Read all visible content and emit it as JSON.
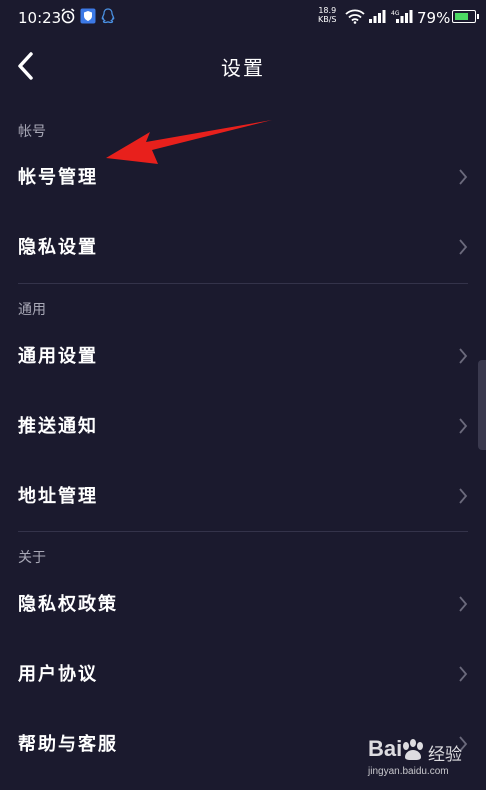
{
  "status_bar": {
    "time": "10:23",
    "net_speed_value": "18.9",
    "net_speed_unit": "KB/S",
    "battery_percent": "79%",
    "battery_level": 0.79,
    "icons": [
      "alarm-icon",
      "shield-icon",
      "qq-icon",
      "wifi-icon",
      "signal-icon",
      "4g-signal-icon",
      "battery-icon"
    ]
  },
  "nav": {
    "title": "设置",
    "back_icon": "chevron-left-icon"
  },
  "sections": [
    {
      "header": "帐号",
      "items": [
        {
          "label": "帐号管理"
        },
        {
          "label": "隐私设置"
        }
      ]
    },
    {
      "header": "通用",
      "items": [
        {
          "label": "通用设置"
        },
        {
          "label": "推送通知"
        },
        {
          "label": "地址管理"
        }
      ]
    },
    {
      "header": "关于",
      "items": [
        {
          "label": "隐私权政策"
        },
        {
          "label": "用户协议"
        },
        {
          "label": "帮助与客服"
        }
      ]
    }
  ],
  "annotation": {
    "icon": "red-arrow-icon",
    "color": "#e8201c"
  },
  "watermark": {
    "logo": "Bai",
    "text": "经验",
    "url": "jingyan.baidu.com"
  },
  "colors": {
    "background": "#1b1a2e",
    "section_header": "#a8a8b6",
    "divider": "#34334a",
    "chevron": "#6b6a7c"
  }
}
